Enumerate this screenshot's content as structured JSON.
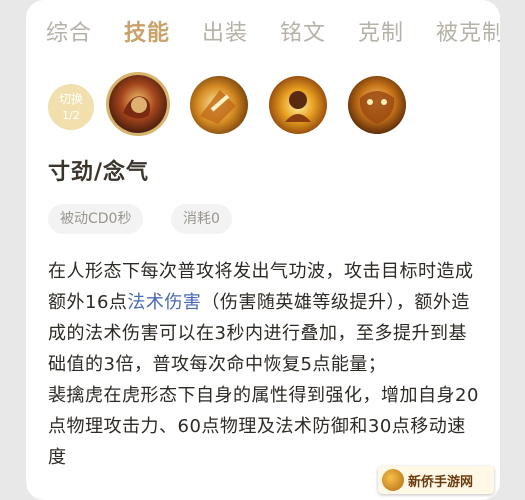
{
  "tabs": [
    {
      "label": "综合",
      "active": false
    },
    {
      "label": "技能",
      "active": true
    },
    {
      "label": "出装",
      "active": false
    },
    {
      "label": "铭文",
      "active": false
    },
    {
      "label": "克制",
      "active": false
    },
    {
      "label": "被克制",
      "active": false
    }
  ],
  "skills": {
    "switch": {
      "line1": "切换",
      "line2": "1/2"
    },
    "icons": [
      {
        "name": "skill-1-icon",
        "selected": true
      },
      {
        "name": "skill-2-icon",
        "selected": false
      },
      {
        "name": "skill-3-icon",
        "selected": false
      },
      {
        "name": "skill-4-icon",
        "selected": false
      }
    ]
  },
  "skill_detail": {
    "title": "寸劲/念气",
    "tags": [
      "被动CD0秒",
      "消耗0"
    ],
    "desc": {
      "p1_a": "在人形态下每次普攻将发出气功波，攻击目标时造成额外16点",
      "p1_hl": "法术伤害",
      "p1_b": "（伤害随英雄等级提升），额外造成的法术伤害可以在3秒内进行叠加，至多提升到基础值的3倍，普攻每次命中恢复5点能量；",
      "p2": "裴擒虎在虎形态下自身的属性得到强化，增加自身20点物理攻击力、60点物理及法术防御和30点移动速度"
    }
  },
  "watermark": {
    "text": "新侨手游网"
  },
  "colors": {
    "accent": "#c8a26a",
    "tab_inactive": "#b7b2a8",
    "highlight": "#4a68b4",
    "text": "#2e2a25"
  }
}
